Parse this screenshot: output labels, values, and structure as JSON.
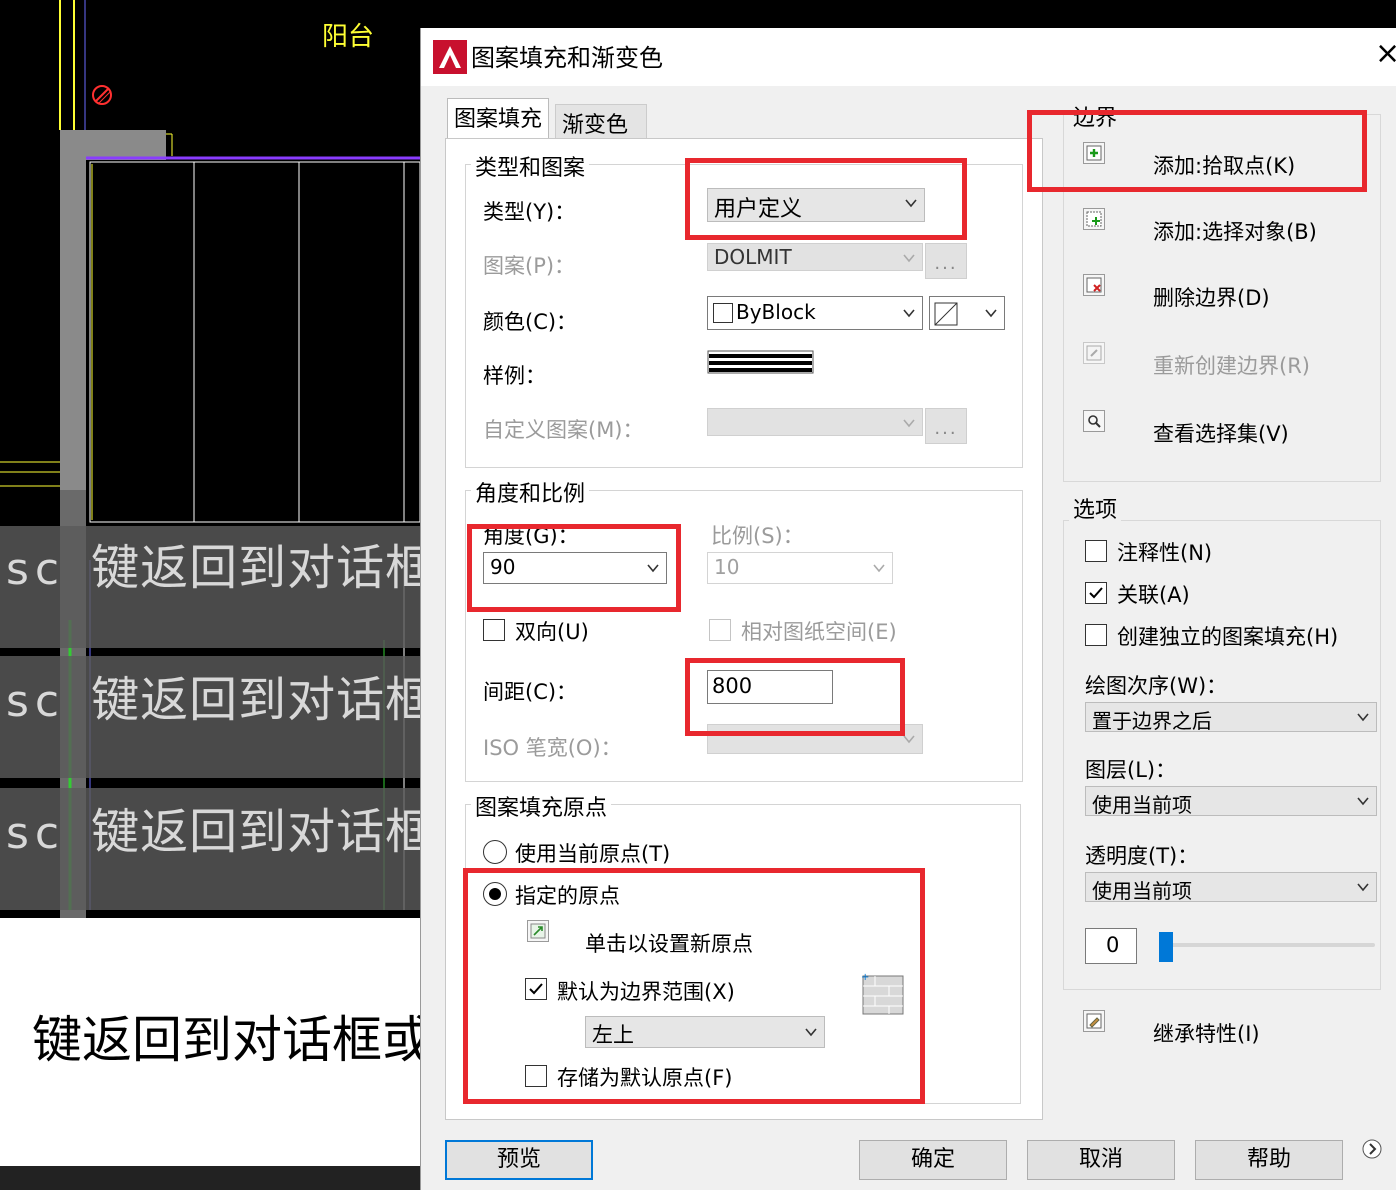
{
  "cad": {
    "balcony_label": "阳台",
    "cmd_prefix": "sc",
    "cmd_lines": [
      "键返回到对话框",
      "键返回到对话框",
      "键返回到对话框"
    ],
    "bottom_text": "键返回到对话框或"
  },
  "dialog": {
    "title": "图案填充和渐变色",
    "close": "×",
    "tabs": [
      "图案填充",
      "渐变色"
    ],
    "type_pattern": {
      "title": "类型和图案",
      "type_label": "类型(Y)：",
      "type_value": "用户定义",
      "pattern_label": "图案(P)：",
      "pattern_value": "DOLMIT",
      "dots": "...",
      "color_label": "颜色(C)：",
      "color_value": "ByBlock",
      "sample_label": "样例：",
      "custom_label": "自定义图案(M)：",
      "custom_dots": "..."
    },
    "angle_scale": {
      "title": "角度和比例",
      "angle_label": "角度(G)：",
      "angle_value": "90",
      "scale_label": "比例(S)：",
      "scale_value": "10",
      "double_label": "双向(U)",
      "double_checked": false,
      "relative_label": "相对图纸空间(E)",
      "relative_checked": false,
      "spacing_label": "间距(C)：",
      "spacing_value": "800",
      "iso_label": "ISO 笔宽(O)："
    },
    "origin": {
      "title": "图案填充原点",
      "use_current_label": "使用当前原点(T)",
      "specified_label": "指定的原点",
      "specified_selected": true,
      "click_set_label": "单击以设置新原点",
      "default_extent_label": "默认为边界范围(X)",
      "default_extent_checked": true,
      "position_value": "左上",
      "store_default_label": "存储为默认原点(F)",
      "store_default_checked": false
    },
    "boundary": {
      "title": "边界",
      "add_pick": "添加:拾取点(K)",
      "add_select": "添加:选择对象(B)",
      "remove": "删除边界(D)",
      "recreate": "重新创建边界(R)",
      "view_selection": "查看选择集(V)"
    },
    "options": {
      "title": "选项",
      "annotative": "注释性(N)",
      "annotative_checked": false,
      "associative": "关联(A)",
      "associative_checked": true,
      "independent": "创建独立的图案填充(H)",
      "independent_checked": false,
      "draw_order_label": "绘图次序(W)：",
      "draw_order_value": "置于边界之后",
      "layer_label": "图层(L)：",
      "layer_value": "使用当前项",
      "transparency_label": "透明度(T)：",
      "transparency_value": "使用当前项",
      "transparency_number": "0",
      "transparency_level": 0
    },
    "inherit": "继承特性(I)",
    "buttons": {
      "preview": "预览",
      "ok": "确定",
      "cancel": "取消",
      "help": "帮助"
    },
    "colors": {
      "highlight": "#e8282e",
      "accent": "#0078d7",
      "cad_yellow": "#ffff33",
      "cad_purple": "#8a3cff"
    }
  }
}
